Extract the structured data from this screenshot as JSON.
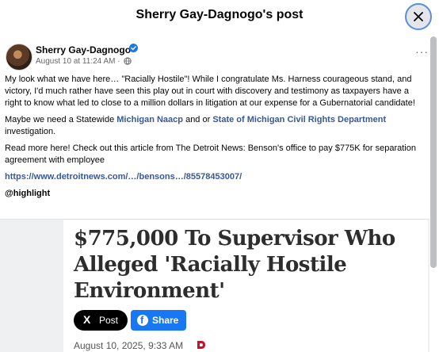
{
  "header": {
    "title": "Sherry Gay-Dagnogo's post",
    "close_icon": "close-icon"
  },
  "post": {
    "author": "Sherry Gay-Dagnogo",
    "timestamp": "August 10 at 11:24 AM",
    "separator": "·",
    "audience_icon": "globe-icon",
    "more_label": "···",
    "paragraph1": "My look what we have here… \"Racially Hostile\"!   While I congratulate Ms. Harness courageous stand, and victory, I'd much rather have seen this play out in court with discovery and testimony as taxpayers have a right to know what led to close to a million dollars in litigation at our expense for a Gubernatorial candidate!",
    "paragraph2": {
      "text_before": "Maybe we need a Statewide ",
      "link1": "Michigan Naacp",
      "text_middle": " and or ",
      "link2": "State of Michigan Civil Rights Department",
      "text_after": " investigation."
    },
    "paragraph3": "Read more here! Check out this article from The Detroit News: Benson's office to pay $775K for separation agreement with employee",
    "url": "https://www.detroitnews.com/…/bensons…/85578453007/",
    "tag": "@highlight"
  },
  "preview": {
    "headline": "$775,000 To Supervisor Who Alleged 'Racially Hostile Environment'",
    "x_post_label": "Post",
    "x_icon": "X",
    "fb_share_label": "Share",
    "fb_icon": "f",
    "date": "August 10, 2025, 9:33 AM"
  },
  "colors": {
    "link": "#385898",
    "fb_blue": "#1877f2",
    "verified": "#1877f2"
  }
}
